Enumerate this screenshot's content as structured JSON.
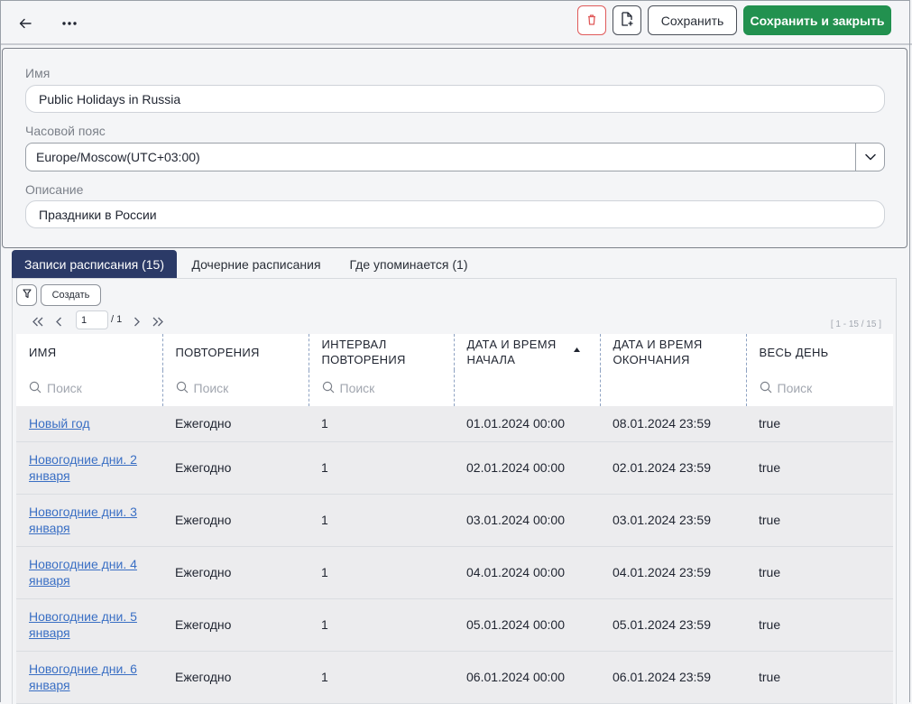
{
  "toolbar": {
    "save_label": "Сохранить",
    "save_close_label": "Сохранить и закрыть"
  },
  "form": {
    "name_label": "Имя",
    "name_value": "Public Holidays in Russia",
    "timezone_label": "Часовой пояс",
    "timezone_value": "Europe/Moscow(UTC+03:00)",
    "description_label": "Описание",
    "description_value": "Праздники в России"
  },
  "tabs": [
    {
      "label": "Записи расписания (15)",
      "active": true
    },
    {
      "label": "Дочерние расписания",
      "active": false
    },
    {
      "label": "Где упоминается (1)",
      "active": false
    }
  ],
  "grid_toolbar": {
    "create_label": "Создать"
  },
  "pager": {
    "current_page": "1",
    "total_pages": "/ 1",
    "range": "[ 1 - 15 / 15 ]"
  },
  "columns": [
    {
      "label": "ИМЯ",
      "searchable": true
    },
    {
      "label": "ПОВТОРЕНИЯ",
      "searchable": true
    },
    {
      "label": "ИНТЕРВАЛ ПОВТОРЕНИЯ",
      "searchable": true
    },
    {
      "label": "ДАТА И ВРЕМЯ НАЧАЛА",
      "searchable": false,
      "sorted": "asc"
    },
    {
      "label": "ДАТА И ВРЕМЯ ОКОНЧАНИЯ",
      "searchable": false
    },
    {
      "label": "ВЕСЬ ДЕНЬ",
      "searchable": true
    }
  ],
  "search_placeholder": "Поиск",
  "rows": [
    {
      "name": "Новый год",
      "repeat": "Ежегодно",
      "interval": "1",
      "start": "01.01.2024 00:00",
      "end": "08.01.2024 23:59",
      "all_day": "true"
    },
    {
      "name": "Новогодние дни. 2 января",
      "repeat": "Ежегодно",
      "interval": "1",
      "start": "02.01.2024 00:00",
      "end": "02.01.2024 23:59",
      "all_day": "true"
    },
    {
      "name": "Новогодние дни. 3 января",
      "repeat": "Ежегодно",
      "interval": "1",
      "start": "03.01.2024 00:00",
      "end": "03.01.2024 23:59",
      "all_day": "true"
    },
    {
      "name": "Новогодние дни. 4 января",
      "repeat": "Ежегодно",
      "interval": "1",
      "start": "04.01.2024 00:00",
      "end": "04.01.2024 23:59",
      "all_day": "true"
    },
    {
      "name": "Новогодние дни. 5 января",
      "repeat": "Ежегодно",
      "interval": "1",
      "start": "05.01.2024 00:00",
      "end": "05.01.2024 23:59",
      "all_day": "true"
    },
    {
      "name": "Новогодние дни. 6 января",
      "repeat": "Ежегодно",
      "interval": "1",
      "start": "06.01.2024 00:00",
      "end": "06.01.2024 23:59",
      "all_day": "true"
    }
  ],
  "colors": {
    "accent_dark": "#2b3a67",
    "success": "#22914f",
    "danger": "#e05a5a",
    "link": "#3a6fc4"
  }
}
